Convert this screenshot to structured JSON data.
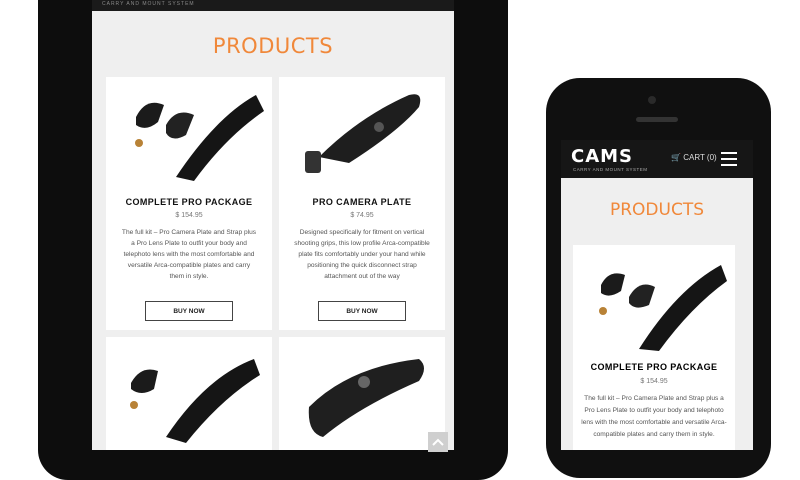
{
  "tablet": {
    "header_tagline": "CARRY AND MOUNT SYSTEM",
    "section_title": "PRODUCTS",
    "products": [
      {
        "name": "COMPLETE PRO PACKAGE",
        "price": "$ 154.95",
        "description": "The full kit – Pro Camera Plate and Strap plus a Pro Lens Plate to outfit your body and telephoto lens with the most comfortable and versatile Arca-compatible plates and carry them in style.",
        "button": "BUY NOW"
      },
      {
        "name": "PRO CAMERA PLATE",
        "price": "$ 74.95",
        "description": "Designed specifically for fitment on vertical shooting grips, this low profile Arca-compatible plate fits comfortably under your hand while positioning the quick disconnect strap attachment out of the way",
        "button": "BUY NOW"
      }
    ]
  },
  "phone": {
    "logo": "CAMS",
    "tagline": "CARRY AND MOUNT SYSTEM",
    "cart": "CART (0)",
    "section_title": "PRODUCTS",
    "product": {
      "name": "COMPLETE PRO PACKAGE",
      "price": "$ 154.95",
      "description": "The full kit – Pro Camera Plate and Strap plus a Pro Lens Plate to outfit your body and telephoto lens with the most comfortable and versatile Arca-compatible plates and carry them in style."
    }
  }
}
